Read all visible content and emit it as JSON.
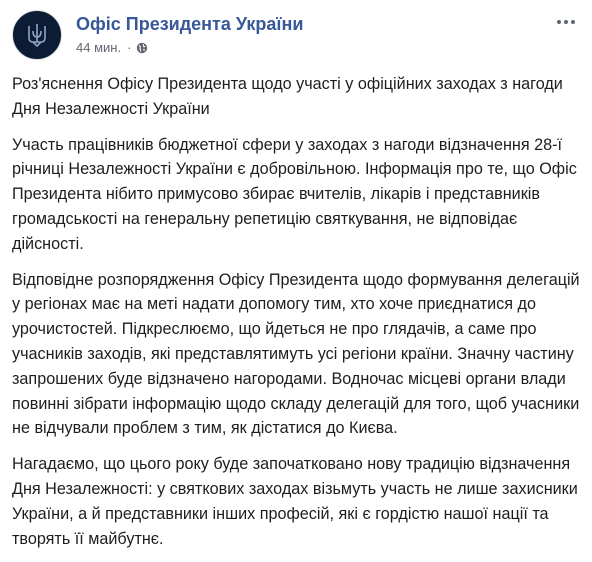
{
  "post": {
    "page_name": "Офіс Президента України",
    "timestamp": "44 мин.",
    "separator": "·",
    "avatar_icon": "trident-icon",
    "privacy_icon": "globe-icon",
    "more_icon": "more-options-icon",
    "colors": {
      "link": "#385898",
      "text": "#1c1e21",
      "meta": "#616770",
      "avatar_bg": "#0c1c34"
    }
  },
  "paragraphs": [
    "Роз'яснення Офісу Президента щодо участі у офіційних заходах з нагоди Дня Незалежності України",
    "Участь працівників бюджетної сфери у заходах з нагоди відзначення 28-ї річниці Незалежності України є добровільною. Інформація про те, що Офіс Президента нібито примусово збирає вчителів, лікарів і представників громадськості на генеральну репетицію святкування, не відповідає дійсності.",
    "Відповідне розпорядження Офісу Президента щодо формування делегацій у регіонах має на меті надати допомогу тим, хто хоче приєднатися до урочистостей. Підкреслюємо, що йдеться не про глядачів, а саме про учасників заходів, які представлятимуть усі регіони країни. Значну частину запрошених буде відзначено нагородами. Водночас місцеві органи влади повинні зібрати інформацію щодо складу делегацій для того, щоб учасники не відчували проблем з тим, як дістатися до Києва.",
    "Нагадаємо, що цього року буде започатковано нову традицію відзначення Дня Незалежності: у святкових заходах візьмуть участь не лише захисники України, а й представники інших професій, які є гордістю нашої нації та творять її майбутнє."
  ]
}
